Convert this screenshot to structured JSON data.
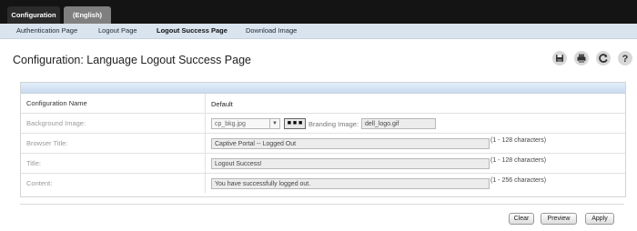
{
  "top_tabs": [
    "Configuration",
    "(English)"
  ],
  "subnav": [
    "Authentication Page",
    "Logout Page",
    "Logout Success Page",
    "Download Image"
  ],
  "page_title": "Configuration: Language Logout Success Page",
  "icons": [
    "save-icon",
    "print-icon",
    "refresh-icon",
    "help-icon"
  ],
  "rows": {
    "config_name": {
      "label": "Configuration Name",
      "value": "Default"
    },
    "background": {
      "label": "Background Image:",
      "select_value": "cp_bkg.jpg",
      "browse_label": "■ ■ ■",
      "branding_label": "Branding Image:",
      "branding_value": "dell_logo.gif"
    },
    "browser_title": {
      "label": "Browser Title:",
      "value": "Captive Portal -- Logged Out",
      "hint": "(1 - 128 characters)"
    },
    "title": {
      "label": "Title:",
      "value": "Logout Success!",
      "hint": "(1 - 128 characters)"
    },
    "content": {
      "label": "Content:",
      "value": "You have successfully logged out.",
      "hint": "(1 - 256 characters)"
    }
  },
  "buttons": {
    "clear": "Clear",
    "preview": "Preview",
    "apply": "Apply"
  }
}
